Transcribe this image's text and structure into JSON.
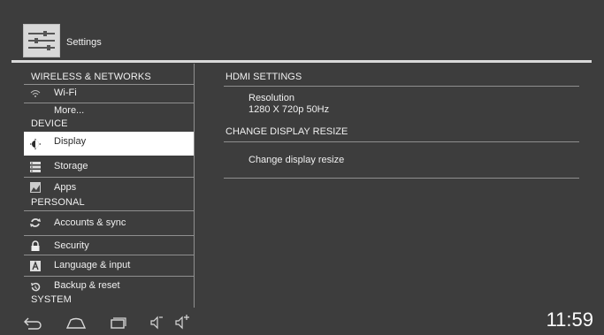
{
  "header": {
    "title": "Settings",
    "icon": "settings-sliders-icon"
  },
  "left_panel": {
    "categories": [
      "WIRELESS & NETWORKS",
      "DEVICE",
      "PERSONAL",
      "SYSTEM"
    ],
    "items": [
      {
        "label": "Wi-Fi",
        "icon": "wifi-icon"
      },
      {
        "label": "More...",
        "icon": ""
      },
      {
        "label": "Display",
        "icon": "brightness-icon",
        "selected": true
      },
      {
        "label": "Storage",
        "icon": "storage-icon"
      },
      {
        "label": "Apps",
        "icon": "apps-icon"
      },
      {
        "label": "Accounts & sync",
        "icon": "sync-icon"
      },
      {
        "label": "Security",
        "icon": "lock-icon"
      },
      {
        "label": "Language & input",
        "icon": "keyboard-a-icon"
      },
      {
        "label": "Backup & reset",
        "icon": "backup-icon"
      }
    ]
  },
  "right_panel": {
    "hdmi_header": "HDMI SETTINGS",
    "resolution_title": "Resolution",
    "resolution_value": "1280 X 720p 50Hz",
    "resize_header": "CHANGE DISPLAY RESIZE",
    "resize_item": "Change display resize"
  },
  "navbar": {
    "clock": "11:59",
    "buttons": [
      "back-icon",
      "home-icon",
      "recent-apps-icon",
      "volume-down-icon",
      "volume-up-icon"
    ]
  },
  "colors": {
    "background": "#3d3d3d",
    "selected_row": "#ffffff",
    "divider": "#8f8f8f"
  }
}
